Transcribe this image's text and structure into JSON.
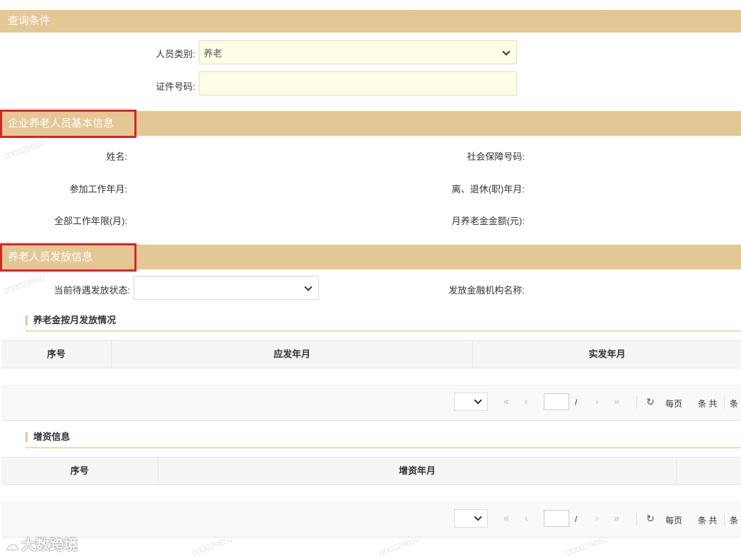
{
  "query": {
    "header": "查询条件",
    "person_type_label": "人员类别:",
    "person_type_value": "养老",
    "id_number_label": "证件号码:",
    "id_number_value": ""
  },
  "basic_info": {
    "header": "企业养老人员基本信息",
    "name_label": "姓名:",
    "ss_number_label": "社会保障号码:",
    "work_start_label": "参加工作年月:",
    "retire_label": "离、退休(职)年月:",
    "total_years_label": "全部工作年限(月):",
    "monthly_amount_label": "月养老金金额(元):"
  },
  "payment_info": {
    "header": "养老人员发放信息",
    "status_label": "当前待遇发放状态:",
    "status_value": "",
    "bank_label": "发放金融机构名称:"
  },
  "monthly_table": {
    "title": "养老金按月发放情况",
    "columns": [
      "序号",
      "应发年月",
      "实发年月"
    ],
    "pager": {
      "slash": "/",
      "per_page": "每页",
      "items_total": "条 共",
      "items": "条"
    }
  },
  "raise_table": {
    "title": "增资信息",
    "columns": [
      "序号",
      "增资年月"
    ],
    "pager": {
      "slash": "/",
      "per_page": "每页",
      "items_total": "条 共",
      "items": "条"
    }
  },
  "brand": {
    "text": "大数跨境"
  },
  "watermark": "000029860",
  "colors": {
    "header_bg": "#e3c795",
    "highlight": "#e02020",
    "input_bg": "#fffde6"
  }
}
